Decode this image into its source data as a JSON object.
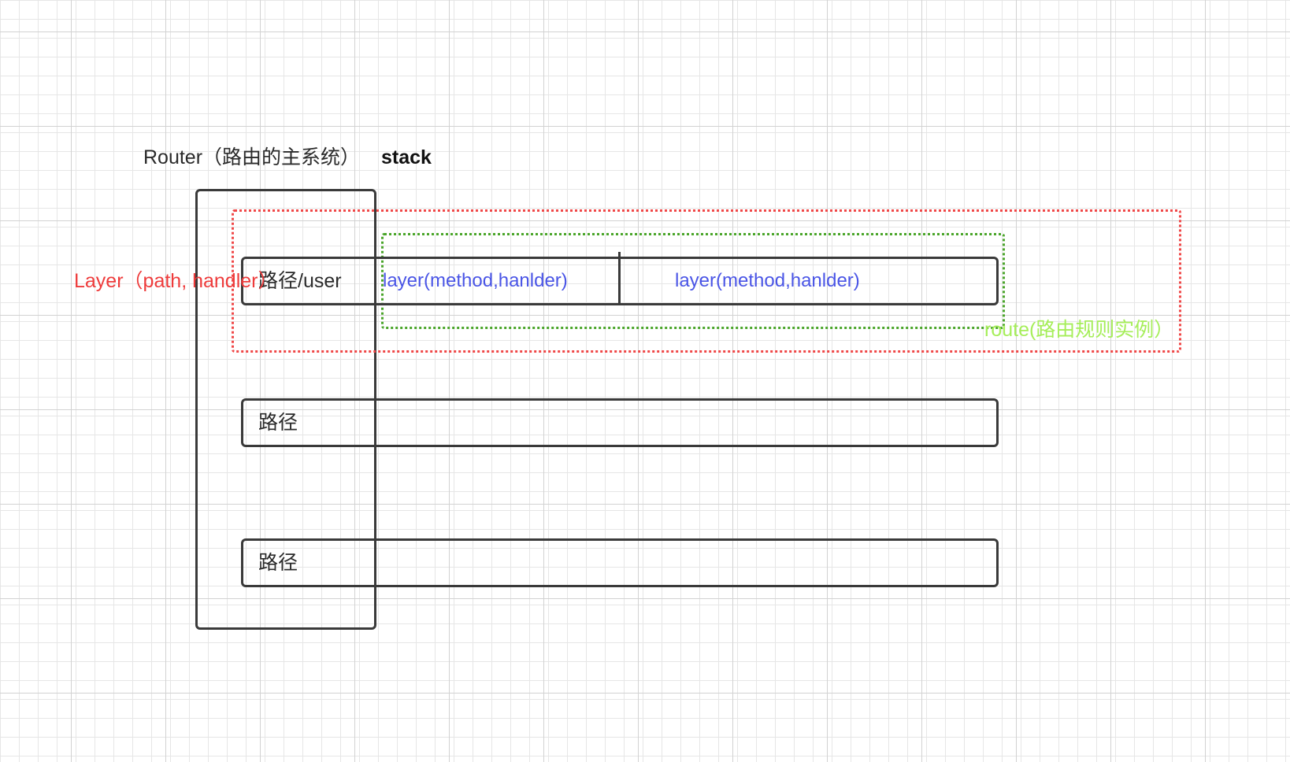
{
  "diagram": {
    "title": "Router（路由的主系统）",
    "stack_label": "stack",
    "layer_label": "Layer（path, handler）",
    "route_label": "route(路由规则实例）",
    "rows": [
      {
        "path": "路径/user",
        "handlers": [
          "layer(method,hanlder)",
          "layer(method,hanlder)"
        ]
      },
      {
        "path": "路径"
      },
      {
        "path": "路径"
      }
    ],
    "colors": {
      "box_stroke": "#3a3a3a",
      "layer_outline": "#f04848",
      "route_outline": "#4aa52a",
      "handler_text": "#4a55e6",
      "route_text": "#a6ee5a",
      "layer_text": "#ee3b3b"
    }
  }
}
